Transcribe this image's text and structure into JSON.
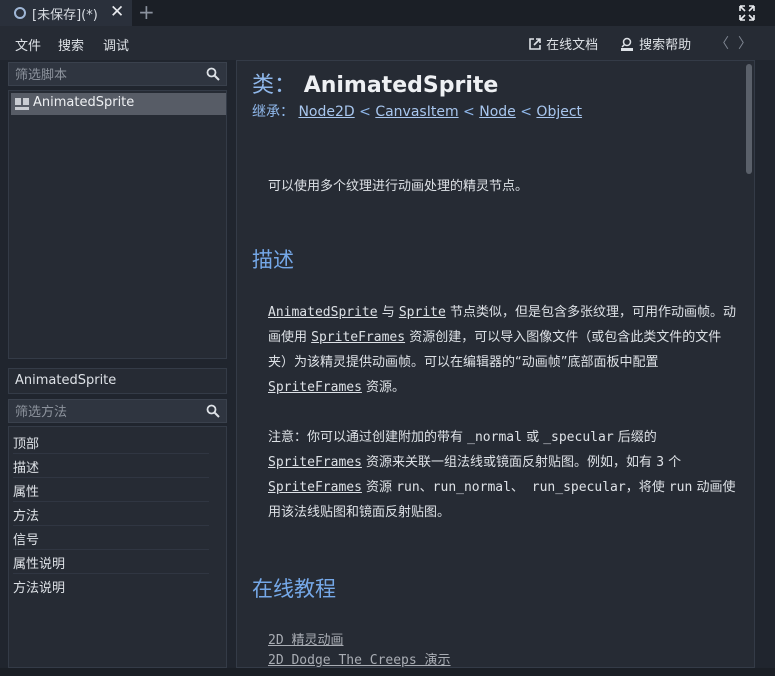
{
  "tab": {
    "title": "[未保存](*)",
    "close": "✕",
    "add": "+"
  },
  "menubar": {
    "file": "文件",
    "search": "搜索",
    "debug": "调试",
    "online_docs": "在线文档",
    "search_help": "搜索帮助",
    "back": "〈",
    "forward": "〉"
  },
  "script_filter": {
    "placeholder": "筛选脚本"
  },
  "scripts": [
    {
      "label": "AnimatedSprite",
      "selected": true
    }
  ],
  "current_class": "AnimatedSprite",
  "method_filter": {
    "placeholder": "筛选方法"
  },
  "sections": [
    "顶部",
    "描述",
    "属性",
    "方法",
    "信号",
    "属性说明",
    "方法说明"
  ],
  "doc": {
    "class_prefix": "类：",
    "class_name": "AnimatedSprite",
    "inherits_label": "继承：",
    "inherits": [
      "Node2D",
      "CanvasItem",
      "Node",
      "Object"
    ],
    "inherits_sep": "<",
    "brief": "可以使用多个纹理进行动画处理的精灵节点。",
    "description_heading": "描述",
    "desc1": {
      "a": "AnimatedSprite",
      "b": " 与 ",
      "c": "Sprite",
      "d": " 节点类似，但是包含多张纹理，可用作动画帧。动画使用 ",
      "e": "SpriteFrames",
      "f": " 资源创建，可以导入图像文件（或包含此类文件的文件夹）为该精灵提供动画帧。可以在编辑器的“动画帧”底部面板中配置 ",
      "g": "SpriteFrames",
      "h": " 资源。"
    },
    "desc2": {
      "a": "注意：你可以通过创建附加的带有 ",
      "b": "_normal",
      "c": " 或 ",
      "d": "_specular",
      "e": " 后缀的 ",
      "f": "SpriteFrames",
      "g": " 资源来关联一组法线或镜面反射贴图。例如，如有 ",
      "h": "3",
      "i": " 个 ",
      "j": "SpriteFrames",
      "k": " 资源 ",
      "l": "run、run_normal、 run_specular",
      "m": "，将使 ",
      "n": "run",
      "o": " 动画使用该法线贴图和镜面反射贴图。"
    },
    "tutorials_heading": "在线教程",
    "tutorials": [
      "2D 精灵动画",
      "2D Dodge The Creeps 演示"
    ]
  }
}
